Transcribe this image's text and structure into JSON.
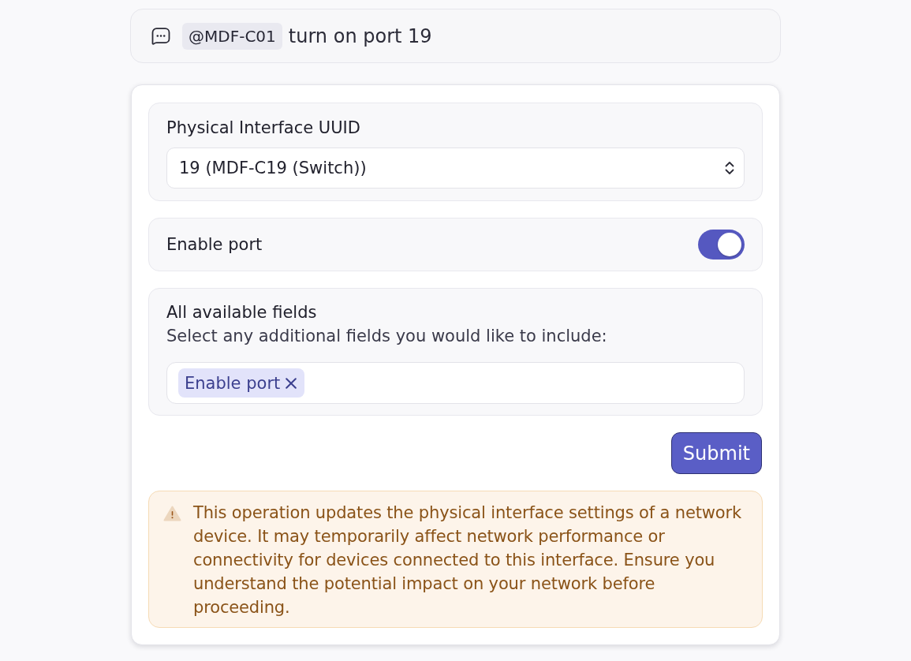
{
  "message": {
    "mention": "@MDF-C01",
    "text": "turn on port 19"
  },
  "form": {
    "sections": [
      {
        "kind": "select",
        "label": "Physical Interface UUID",
        "value": "19 (MDF-C19 (Switch))"
      },
      {
        "kind": "toggle",
        "label": "Enable port",
        "on": true
      },
      {
        "kind": "multiselect",
        "label": "All available fields",
        "hint": "Select any additional fields you would like to include:",
        "tags": [
          "Enable port"
        ]
      }
    ],
    "submit": "Submit",
    "warning": "This operation updates the physical interface settings of a network device. It may temporarily affect network performance or connectivity for devices connected to this interface. Ensure you understand the potential impact on your network before proceeding."
  }
}
